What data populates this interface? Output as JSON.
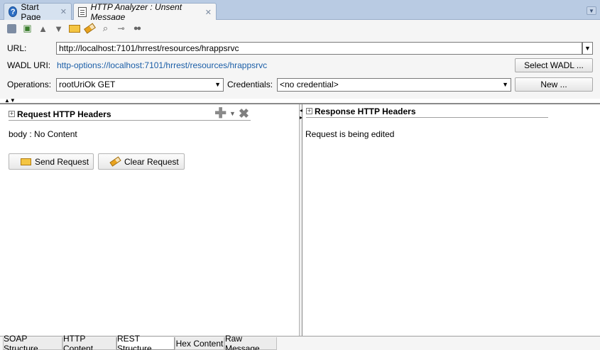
{
  "tabs": [
    {
      "label": "Start Page",
      "icon": "help-icon",
      "active": false
    },
    {
      "label": "HTTP Analyzer : Unsent Message",
      "icon": "document-icon",
      "active": true
    }
  ],
  "tab_close_glyph": "✕",
  "toolbar": {
    "icons": [
      "save-icon",
      "export-icon",
      "previous-icon",
      "next-icon",
      "send-icon",
      "clear-icon",
      "inspect-icon",
      "key-icon",
      "binoculars-icon"
    ]
  },
  "form": {
    "url_label": "URL:",
    "url_value": "http://localhost:7101/hrrest/resources/hrappsrvc",
    "wadl_label": "WADL URI:",
    "wadl_value": "http-options://localhost:7101/hrrest/resources/hrappsrvc",
    "select_wadl_button": "Select WADL ...",
    "operations_label": "Operations:",
    "operations_value": "rootUriOk GET",
    "credentials_label": "Credentials:",
    "credentials_value": "<no credential>",
    "new_button": "New ..."
  },
  "request": {
    "header_title": "Request HTTP Headers",
    "body_text": "body : No Content",
    "send_button": "Send Request",
    "clear_button": "Clear Request"
  },
  "response": {
    "header_title": "Response HTTP Headers",
    "status_text": "Request is being edited"
  },
  "bottom_tabs": [
    {
      "label": "SOAP Structure",
      "active": false
    },
    {
      "label": "HTTP Content",
      "active": false
    },
    {
      "label": "REST Structure",
      "active": true
    },
    {
      "label": "Hex Content",
      "active": false
    },
    {
      "label": "Raw Message",
      "active": false
    }
  ],
  "colors": {
    "tabstrip": "#b9cbe3",
    "link": "#1b5ea7",
    "background": "#f5f5f5"
  }
}
